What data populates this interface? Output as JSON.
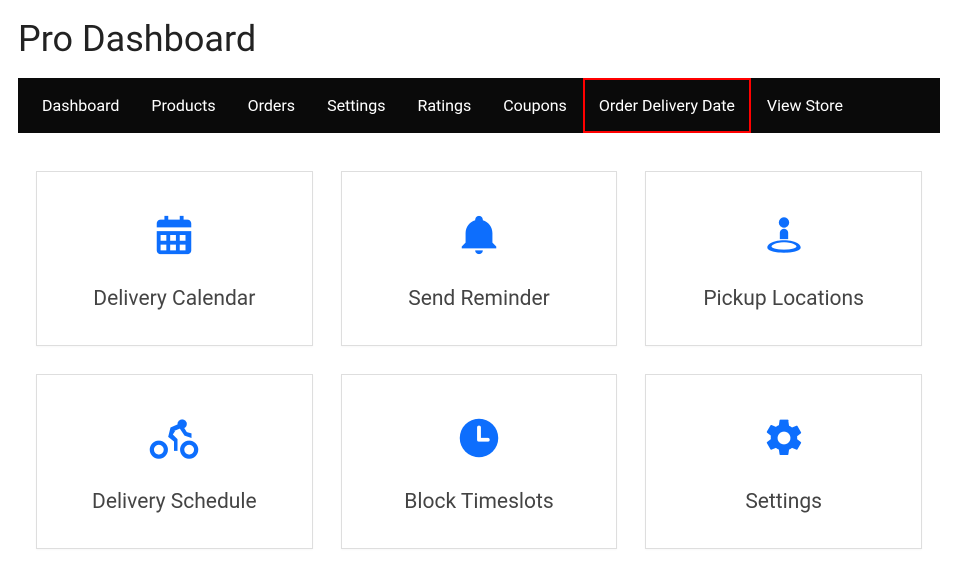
{
  "page": {
    "title": "Pro Dashboard"
  },
  "nav": {
    "items": [
      {
        "label": "Dashboard",
        "highlighted": false
      },
      {
        "label": "Products",
        "highlighted": false
      },
      {
        "label": "Orders",
        "highlighted": false
      },
      {
        "label": "Settings",
        "highlighted": false
      },
      {
        "label": "Ratings",
        "highlighted": false
      },
      {
        "label": "Coupons",
        "highlighted": false
      },
      {
        "label": "Order Delivery Date",
        "highlighted": true
      },
      {
        "label": "View Store",
        "highlighted": false
      }
    ]
  },
  "cards": [
    {
      "label": "Delivery Calendar",
      "icon": "calendar-icon"
    },
    {
      "label": "Send Reminder",
      "icon": "bell-icon"
    },
    {
      "label": "Pickup Locations",
      "icon": "location-person-icon"
    },
    {
      "label": "Delivery Schedule",
      "icon": "bike-icon"
    },
    {
      "label": "Block Timeslots",
      "icon": "clock-icon"
    },
    {
      "label": "Settings",
      "icon": "gear-icon"
    }
  ],
  "colors": {
    "accent": "#0d6efd",
    "nav_bg": "#0a0a0a",
    "highlight_border": "#ff0000"
  }
}
